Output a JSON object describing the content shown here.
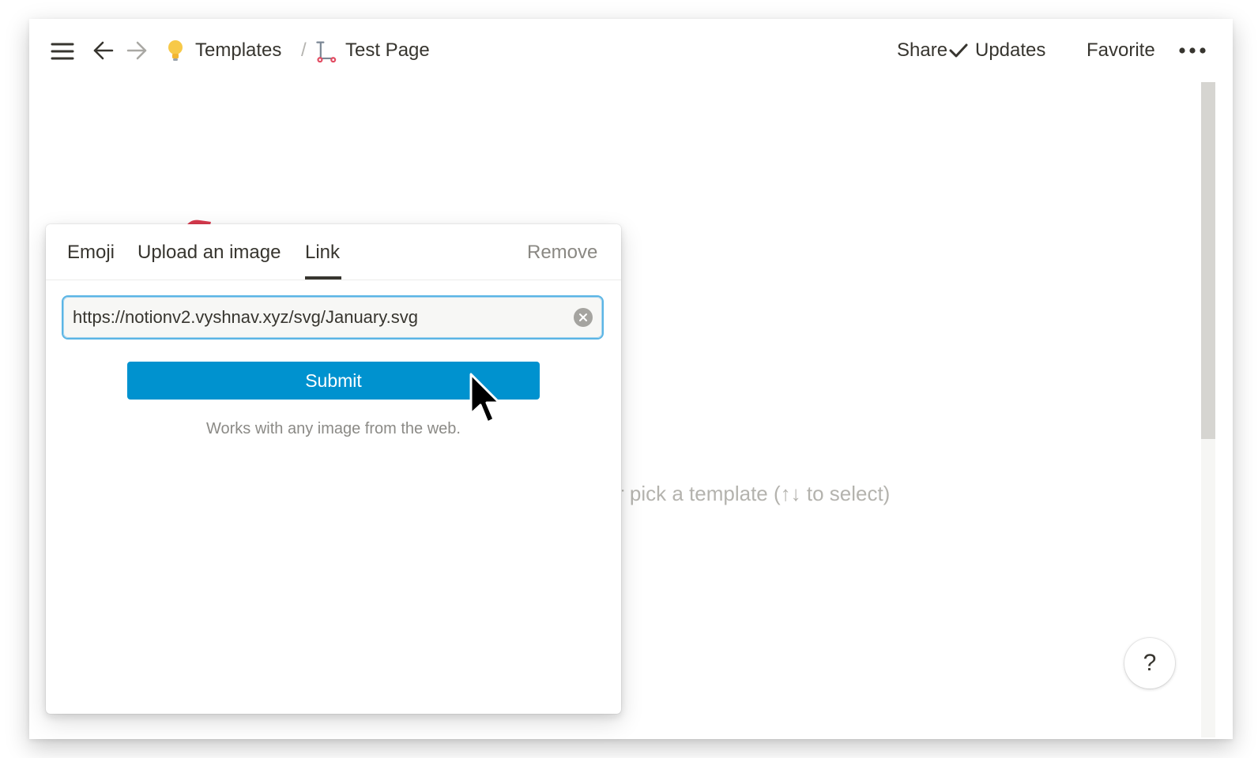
{
  "topbar": {
    "breadcrumb": [
      {
        "label": "Templates",
        "icon": "lightbulb-icon"
      },
      {
        "label": "Test Page",
        "icon": "scooter-icon"
      }
    ],
    "separator": "/",
    "actions": {
      "share": "Share",
      "updates": "Updates",
      "favorite": "Favorite"
    }
  },
  "editor": {
    "placeholder": "r pick a template (↑↓ to select)"
  },
  "icon_picker": {
    "tabs": {
      "emoji": "Emoji",
      "upload": "Upload an image",
      "link": "Link"
    },
    "active_tab": "Link",
    "remove_label": "Remove",
    "url_value": "https://notionv2.vyshnav.xyz/svg/January.svg",
    "submit_label": "Submit",
    "hint": "Works with any image from the web."
  },
  "help": {
    "label": "?"
  },
  "colors": {
    "accent": "#0092cf",
    "text": "#37352f",
    "input_focus": "#5bb5e5"
  }
}
